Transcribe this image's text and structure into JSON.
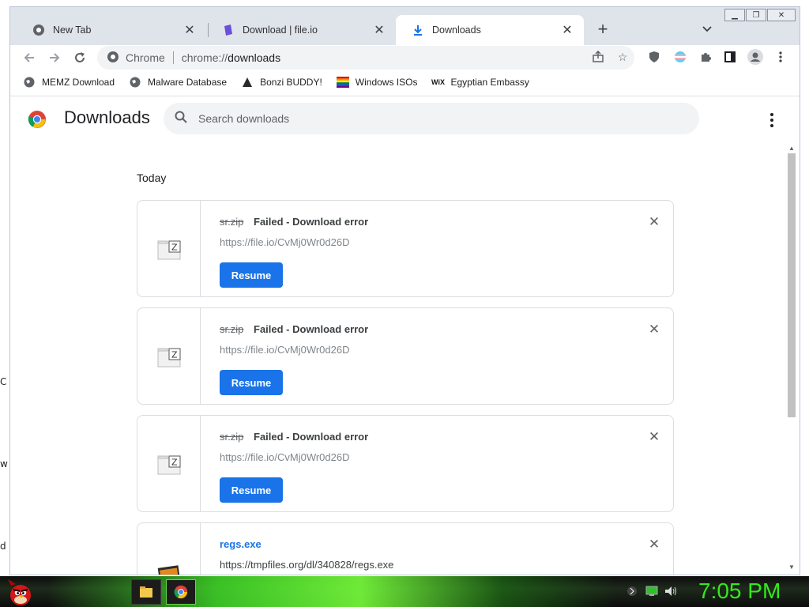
{
  "desktop": {
    "fragments": [
      "C",
      "w",
      "d"
    ]
  },
  "tabs": [
    {
      "title": "New Tab",
      "icon": "chrome-icon"
    },
    {
      "title": "Download | file.io",
      "icon": "fileio-icon"
    },
    {
      "title": "Downloads",
      "icon": "download-icon",
      "active": true
    }
  ],
  "toolbar": {
    "site_chip": "Chrome",
    "url_prefix": "chrome://",
    "url_host": "downloads"
  },
  "bookmarks": [
    {
      "label": "MEMZ Download",
      "icon": "globe-icon"
    },
    {
      "label": "Malware Database",
      "icon": "globe-icon"
    },
    {
      "label": "Bonzi BUDDY!",
      "icon": "bonzi-icon"
    },
    {
      "label": "Windows ISOs",
      "icon": "rainbow-flag-icon"
    },
    {
      "label": "Egyptian Embassy",
      "icon": "wix-icon"
    }
  ],
  "downloads_page": {
    "title": "Downloads",
    "search_placeholder": "Search downloads",
    "date_label": "Today",
    "items": [
      {
        "filename": "sr.zip",
        "status": "Failed - Download error",
        "url": "https://file.io/CvMj0Wr0d26D",
        "button": "Resume"
      },
      {
        "filename": "sr.zip",
        "status": "Failed - Download error",
        "url": "https://file.io/CvMj0Wr0d26D",
        "button": "Resume"
      },
      {
        "filename": "sr.zip",
        "status": "Failed - Download error",
        "url": "https://file.io/CvMj0Wr0d26D",
        "button": "Resume"
      },
      {
        "filename": "regs.exe",
        "status": "",
        "url": "https://tmpfiles.org/dl/340828/regs.exe"
      }
    ]
  },
  "taskbar": {
    "clock": "7:05 PM",
    "accent": "#35e81d"
  }
}
